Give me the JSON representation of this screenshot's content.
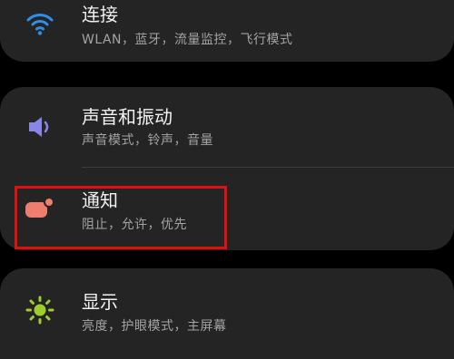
{
  "settings": {
    "items": [
      {
        "title": "连接",
        "subtitle": "WLAN，蓝牙，流量监控，飞行模式",
        "icon": "wifi-icon",
        "icon_color": "#2f8fe6"
      },
      {
        "title": "声音和振动",
        "subtitle": "声音模式，铃声，音量",
        "icon": "speaker-icon",
        "icon_color": "#8a86e8"
      },
      {
        "title": "通知",
        "subtitle": "阻止，允许，优先",
        "icon": "notification-icon",
        "icon_color": "#ef7d6f"
      },
      {
        "title": "显示",
        "subtitle": "亮度，护眼模式，主屏幕",
        "icon": "sun-icon",
        "icon_color": "#9ccf2e"
      }
    ]
  },
  "highlight_color": "#e01010"
}
